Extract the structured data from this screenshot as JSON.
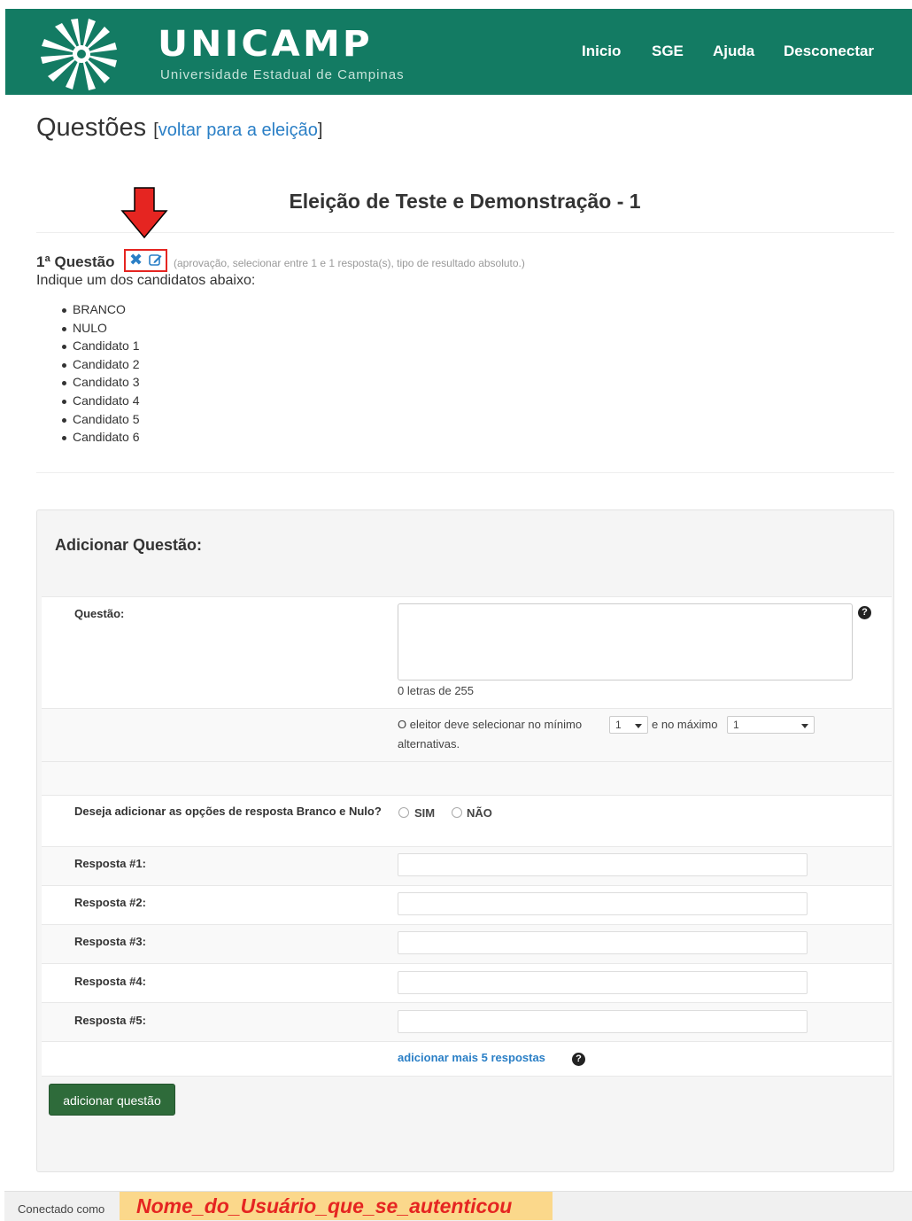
{
  "header": {
    "brand": "UNICAMP",
    "subtitle": "Universidade Estadual de Campinas",
    "nav": [
      "Inicio",
      "SGE",
      "Ajuda",
      "Desconectar"
    ],
    "bg_color": "#137b63"
  },
  "page": {
    "title": "Questões",
    "back_open": "[",
    "back_link": "voltar para a eleição",
    "back_close": "]"
  },
  "election": {
    "title": "Eleição de Teste e Demonstração - 1"
  },
  "question": {
    "heading": "1ª Questão",
    "delete_icon": "✖",
    "meta": "(aprovação, selecionar entre 1 e 1 resposta(s), tipo de resultado absoluto.)",
    "text": "Indique um dos candidatos abaixo:",
    "answers": [
      "BRANCO",
      "NULO",
      "Candidato 1",
      "Candidato 2",
      "Candidato 3",
      "Candidato 4",
      "Candidato 5",
      "Candidato 6"
    ]
  },
  "form": {
    "title": "Adicionar Questão:",
    "question_label": "Questão:",
    "question_value": "",
    "char_count": "0 letras de 255",
    "min_prefix": "O eleitor deve selecionar no mínimo",
    "min_value": "1",
    "max_prefix": "e no máximo",
    "max_value": "1",
    "suffix": "alternativas.",
    "blank_null_label": "Deseja adicionar as opções de resposta Branco e Nulo?",
    "yes_label": "SIM",
    "no_label": "NÃO",
    "answer_labels": [
      "Resposta #1:",
      "Resposta #2:",
      "Resposta #3:",
      "Resposta #4:",
      "Resposta #5:"
    ],
    "add_more": "adicionar mais 5 respostas",
    "submit": "adicionar questão",
    "help_glyph": "?"
  },
  "footer": {
    "connected_as": "Conectado como",
    "username": "Nome_do_Usuário_que_se_autenticou"
  }
}
